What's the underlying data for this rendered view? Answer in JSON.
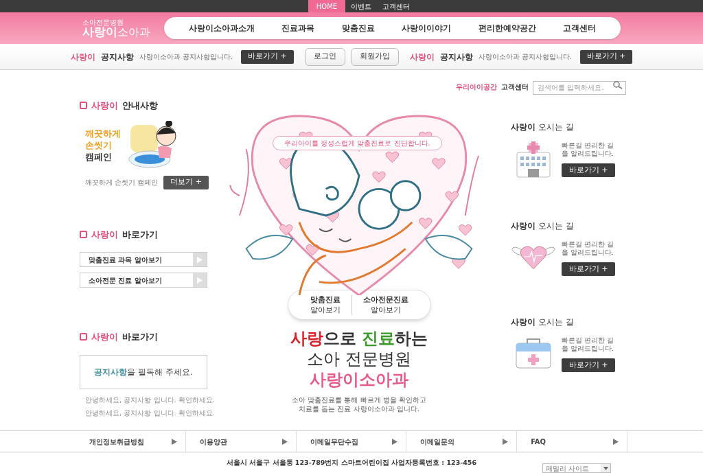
{
  "top_bar": {
    "tabs": [
      {
        "label": "HOME",
        "selected": true
      },
      {
        "label": "이벤트",
        "selected": false
      },
      {
        "label": "고객센터",
        "selected": false
      }
    ]
  },
  "logo": {
    "tagline": "소아전문병원",
    "name_bold": "사랑이",
    "name_light": "소아과"
  },
  "nav": [
    "사랑이소아과소개",
    "진료과목",
    "맞춤진료",
    "사랑이이야기",
    "편리한예약공간",
    "고객센터"
  ],
  "notice_bar": {
    "notices": [
      {
        "brand": "사랑이",
        "title": "공지사항",
        "text": "사랑이소아과 공지사항입니다.",
        "button": "바로가기 +"
      },
      {
        "brand": "사랑이",
        "title": "공지사항",
        "text": "사랑이소아과 공지사항입니다.",
        "button": "바로가기 +"
      }
    ],
    "buttons": [
      "로그인",
      "회원가입"
    ]
  },
  "utility": {
    "links": [
      "우리아이공간",
      "고객센터"
    ],
    "search": {
      "placeholder": "검색어를 입력하세요."
    }
  },
  "left": {
    "guide": {
      "brand": "사랑이",
      "title": "안내사항",
      "campaign_lines": [
        {
          "text": "깨끗하게",
          "color": "#f0a020"
        },
        {
          "text": "손씻기",
          "color": "#f0a020"
        },
        {
          "text": "캠페인",
          "color": "#333333"
        }
      ],
      "caption": "깨끗하게 손씻기 캠페인",
      "button": "더보기 +"
    },
    "shortcuts": {
      "brand": "사랑이",
      "title": "바로가기",
      "items": [
        "맞춤진료 과목 알아보기",
        "소아전문 진료 알아보기"
      ]
    },
    "notice": {
      "brand": "사랑이",
      "title": "바로가기",
      "highlight": "공지사항",
      "message": "을 필독해 주세요.",
      "lines": [
        "안녕하세요, 공지사항 입니다. 확인하세요.",
        "안녕하세요, 공지사항 입니다. 확인하세요."
      ]
    }
  },
  "hero": {
    "banner": "우리아이를 정성스럽게 맞춤진료로 진단합니다.",
    "buttons": [
      {
        "line1": "맞춤진료",
        "line2": "알아보기"
      },
      {
        "line1": "소아전문진료",
        "line2": "알아보기"
      }
    ],
    "headline": [
      {
        "text": "사랑",
        "color": "#d8202a"
      },
      {
        "text": "으로 ",
        "color": "#333333"
      },
      {
        "text": "진료",
        "color": "#3a9a28"
      },
      {
        "text": "하는",
        "color": "#333333"
      }
    ],
    "subhead": "소아 전문병원",
    "brand": "사랑이소아과",
    "description": [
      "소아 맞춤진료를 통해 빠르게 병을 확인하고",
      "치료를 돕는 진료 사랑이소아과 입니다."
    ]
  },
  "right": {
    "cards": [
      {
        "kind": "hospital",
        "brand": "사랑이",
        "title": "오시는 길",
        "text": "빠른길 편리한 길을 알려드립니다.",
        "button": "바로가기 +"
      },
      {
        "kind": "heart",
        "brand": "사랑이",
        "title": "오시는 길",
        "text": "빠른길 편리한 길을 알려드립니다.",
        "button": "바로가기 +"
      },
      {
        "kind": "medkit",
        "brand": "사랑이",
        "title": "오시는 길",
        "text": "빠른길 편리한 길을 알려드립니다.",
        "button": "바로가기 +"
      }
    ]
  },
  "footer": {
    "links": [
      "개인정보취급방침",
      "이용양관",
      "이메일무단수집",
      "이메일문의",
      "FAQ"
    ],
    "address": "서울시 서울구 서울동 123-789번지 스마트어린이집 사업자등록번호 : 123-456",
    "family_site": "패밀리 사이트"
  }
}
